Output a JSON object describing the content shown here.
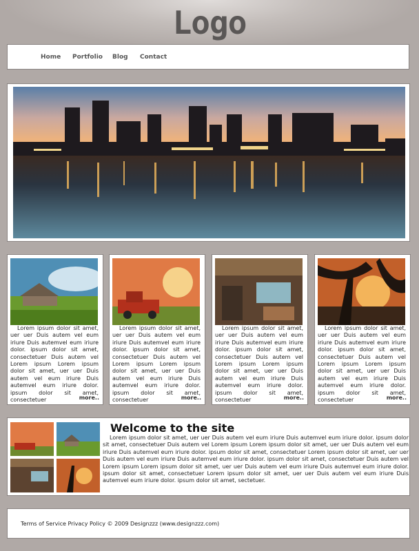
{
  "header": {
    "logo_text": "Logo"
  },
  "nav": {
    "items": [
      "Home",
      "Portfolio",
      "Blog",
      "Contact"
    ]
  },
  "cards": [
    {
      "image": "cottage-landscape-image",
      "text": "Lorem ipsum dolor sit amet, uer uer Duis autem vel eum iriure Duis autemvel eum iriure dolor. ipsum dolor sit amet, consectetuer Duis autem vel Lorem ipsum Lorem ipsum dolor sit amet, uer uer Duis autem vel eum iriure Duis autemvel eum iriure dolor. ipsum dolor sit amet, consectetuer",
      "more": "more.."
    },
    {
      "image": "red-truck-image",
      "text": "Lorem ipsum dolor sit amet, uer uer Duis autem vel eum iriure Duis autemvel eum iriure dolor. ipsum dolor sit amet, consectetuer Duis autem vel Lorem ipsum Lorem ipsum dolor sit amet, uer uer Duis autem vel eum iriure Duis autemvel eum iriure dolor. ipsum dolor sit amet, consectetuer",
      "more": "more.."
    },
    {
      "image": "workshop-image",
      "text": "Lorem ipsum dolor sit amet, uer uer Duis autem vel eum iriure Duis autemvel eum iriure dolor. ipsum dolor sit amet, consectetuer Duis autem vel Lorem ipsum Lorem ipsum dolor sit amet, uer uer Duis autem vel eum iriure Duis autemvel eum iriure dolor. ipsum dolor sit amet, consectetuer",
      "more": "more.."
    },
    {
      "image": "tree-sunset-image",
      "text": "Lorem ipsum dolor sit amet, uer uer Duis autem vel eum iriure Duis autemvel eum iriure dolor. ipsum dolor sit amet, consectetuer Duis autem vel Lorem ipsum Lorem ipsum dolor sit amet, uer uer Duis autem vel eum iriure Duis autemvel eum iriure dolor. ipsum dolor sit amet, consectetuer",
      "more": "more.."
    }
  ],
  "welcome": {
    "title": "Welcome to the site",
    "body": "Lorem ipsum dolor sit amet, uer uer Duis autem vel eum iriure Duis autemvel eum iriure dolor. ipsum dolor sit amet, consectetuer Duis autem vel Lorem ipsum Lorem ipsum dolor sit amet, uer uer Duis autem vel eum iriure Duis autemvel eum iriure dolor. ipsum dolor sit amet, consectetuer Lorem ipsum dolor sit amet, uer uer Duis autem vel eum iriure Duis autemvel eum iriure dolor. ipsum dolor sit amet, consectetuer Duis autem vel Lorem ipsum Lorem ipsum dolor sit amet, uer uer Duis autem vel eum iriure Duis autemvel eum iriure dolor. ipsum dolor sit amet, consectetuer Lorem ipsum dolor sit amet, uer uer Duis autem vel eum iriure Duis autemvel eum iriure dolor. ipsum dolor sit amet, sectetuer."
  },
  "footer": {
    "text": "Terms of Service Privacy Policy © 2009 Designzzz (www.designzzz.com)"
  },
  "colors": {
    "background": "#b0a9a6",
    "panel": "#ffffff",
    "border": "#8a8482",
    "logo": "#5a5756"
  }
}
